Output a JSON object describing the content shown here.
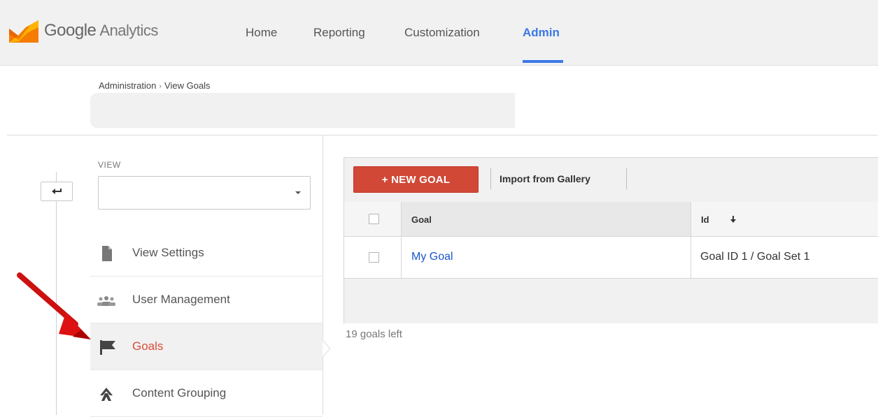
{
  "header": {
    "logo_brand": "Google",
    "logo_product": "Analytics",
    "nav": [
      {
        "label": "Home"
      },
      {
        "label": "Reporting"
      },
      {
        "label": "Customization"
      },
      {
        "label": "Admin",
        "active": true
      }
    ],
    "accent_color": "#3b78e7"
  },
  "breadcrumb": {
    "root": "Administration",
    "separator": "›",
    "current": "View Goals"
  },
  "sidebar": {
    "view_label": "VIEW",
    "view_select_value": "",
    "items": [
      {
        "label": "View Settings",
        "icon": "document-icon"
      },
      {
        "label": "User Management",
        "icon": "users-icon"
      },
      {
        "label": "Goals",
        "icon": "flag-icon",
        "active": true
      },
      {
        "label": "Content Grouping",
        "icon": "content-grouping-icon"
      }
    ],
    "active_color": "#dd4b39"
  },
  "goals": {
    "new_goal_label": "+ NEW GOAL",
    "import_label": "Import from Gallery",
    "columns": [
      "Goal",
      "Id"
    ],
    "rows": [
      {
        "goal": "My Goal",
        "id": "Goal ID 1 / Goal Set 1"
      }
    ],
    "goals_left_text": "19 goals left",
    "button_color": "#d14836"
  }
}
